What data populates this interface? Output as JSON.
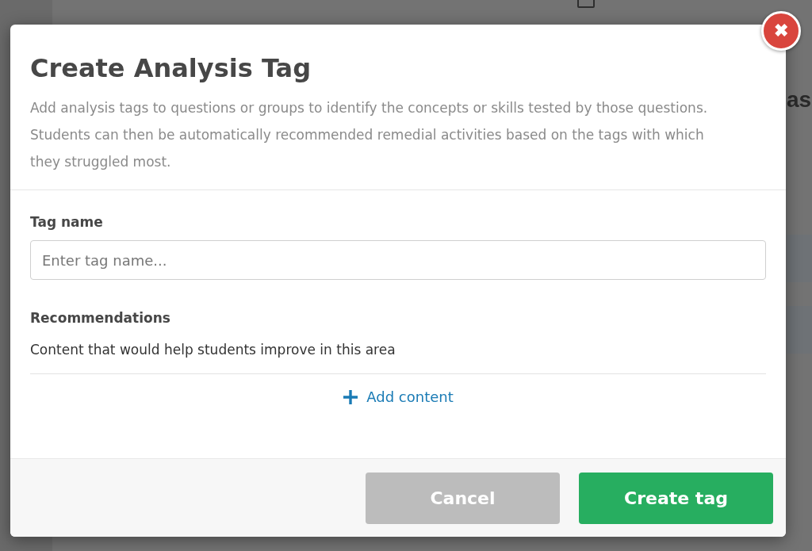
{
  "background": {
    "side_fragments": [
      "as"
    ]
  },
  "dialog": {
    "title": "Create Analysis Tag",
    "description": "Add analysis tags to questions or groups to identify the concepts or skills tested by those questions. Students can then be automatically recommended remedial activities based on the tags with which they struggled most.",
    "close_icon": "✖",
    "fields": [
      {
        "label": "Tag name",
        "placeholder": "Enter tag name..."
      }
    ],
    "recommendations": {
      "label": "Recommendations",
      "hint": "Content that would help students improve in this area",
      "add_link": "Add content"
    },
    "buttons": [
      {
        "label": "Cancel",
        "kind": "secondary"
      },
      {
        "label": "Create tag",
        "kind": "primary"
      }
    ]
  }
}
